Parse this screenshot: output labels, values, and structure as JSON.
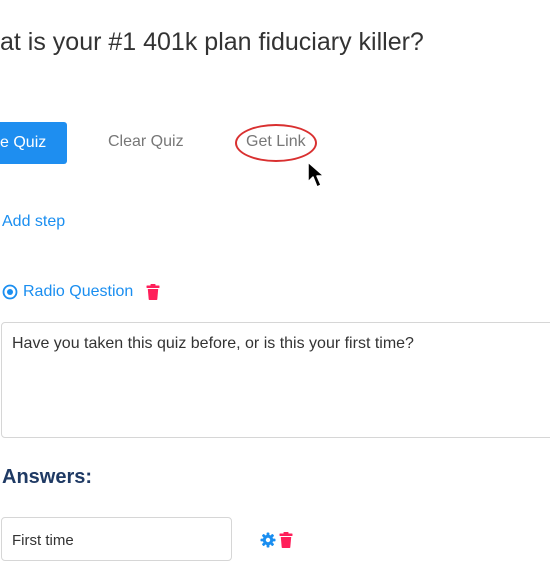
{
  "quiz": {
    "title": "at is your #1 401k plan fiduciary killer?"
  },
  "toolbar": {
    "save_label": "e Quiz",
    "clear_label": "Clear Quiz",
    "link_label": "Get Link"
  },
  "steps": {
    "add_label": "Add step"
  },
  "question": {
    "type_label": "Radio Question",
    "text": "Have you taken this quiz before, or is this your first time?"
  },
  "answers": {
    "heading": "Answers:",
    "items": [
      {
        "value": "First time"
      }
    ]
  },
  "colors": {
    "primary": "#1e8ef0",
    "link": "#1a8ef0",
    "delete": "#ff1f5a",
    "heading": "#1f3a64",
    "annotation": "#d93030"
  },
  "icons": {
    "question_type": "radio-icon",
    "delete": "trash-icon",
    "settings": "gear-icon",
    "pointer": "mouse-cursor-icon"
  }
}
